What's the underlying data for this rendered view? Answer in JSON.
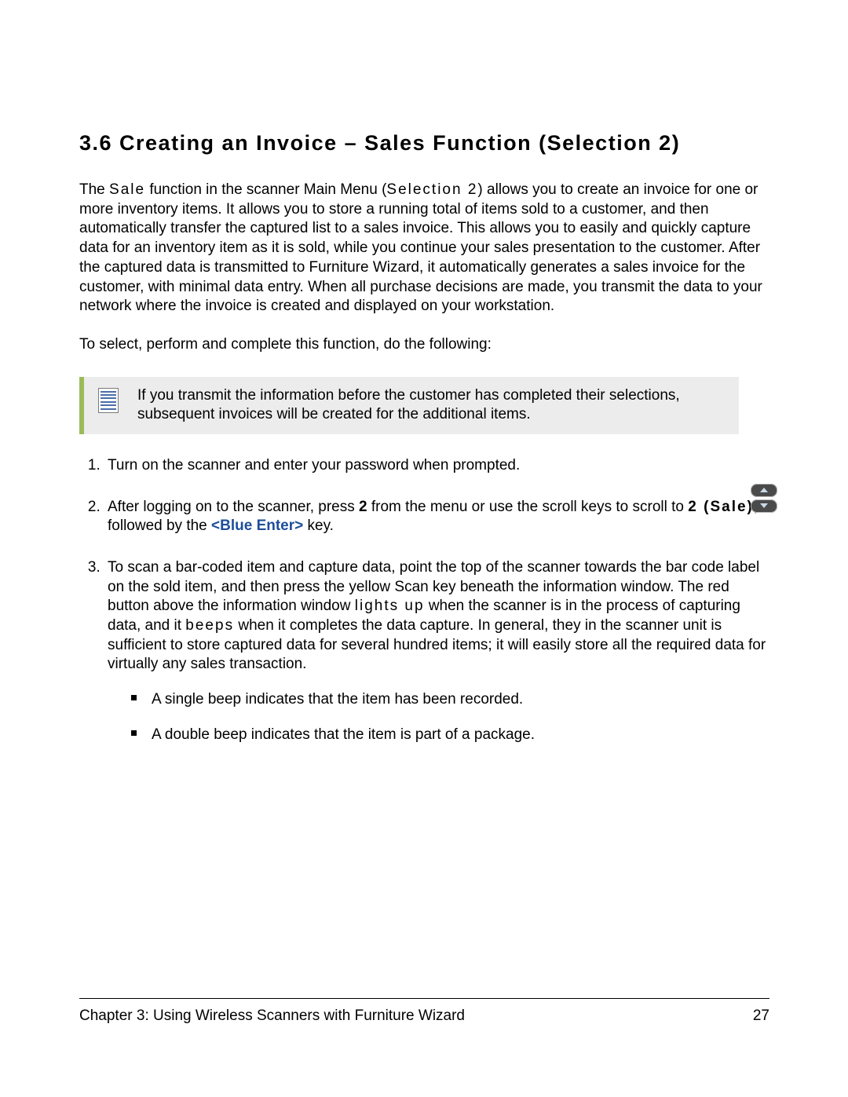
{
  "heading": "3.6 Creating an Invoice – Sales Function (Selection 2)",
  "intro": {
    "p1_a": "The ",
    "p1_sale": "Sale",
    "p1_b": " function in the scanner Main Menu (",
    "p1_sel": "Selection 2",
    "p1_c": ") allows you to create an invoice for one or more inventory items. It allows you to store a running total of items sold to a customer, and then automatically transfer the captured list to a sales invoice. This allows you to easily and quickly capture data for an inventory item as it is sold, while you continue your sales presentation to the customer. After the captured data is transmitted to Furniture Wizard, it automatically generates a sales invoice for the customer, with minimal data entry. When all purchase decisions are made, you transmit the data to your network where the invoice is created and displayed on your workstation.",
    "p2": "To select, perform and complete this function, do the following:"
  },
  "note": "If you transmit the information before the customer has completed their selections, subsequent invoices will be created for the additional items.",
  "steps": {
    "s1": "Turn on the scanner and enter your password when prompted.",
    "s2_a": "After logging on to the scanner, press ",
    "s2_b": "2",
    "s2_c": " from the menu or use the scroll keys to scroll to ",
    "s2_d": "2 (Sale)",
    "s2_e": ", followed by the ",
    "s2_blue": "<Blue Enter>",
    "s2_f": " key.",
    "s3_a": "To scan a bar-coded item and capture data, point the top of the scanner towards the bar code label on the sold item, and then press the yellow Scan key beneath the information window. The red button above the information window ",
    "s3_lights": "lights up",
    "s3_b": " when the scanner is in the process of capturing data, and it ",
    "s3_beeps": "beeps",
    "s3_c": " when it completes the data capture. In general, they in the scanner unit is sufficient to store captured data for several hundred items; it will easily store all the required data for virtually any sales transaction.",
    "s3_sub1": "A single beep indicates that the item has been recorded.",
    "s3_sub2": "A double beep indicates that the item is part of a package."
  },
  "footer": {
    "left": "Chapter 3: Using Wireless Scanners with Furniture Wizard",
    "right": "27"
  }
}
